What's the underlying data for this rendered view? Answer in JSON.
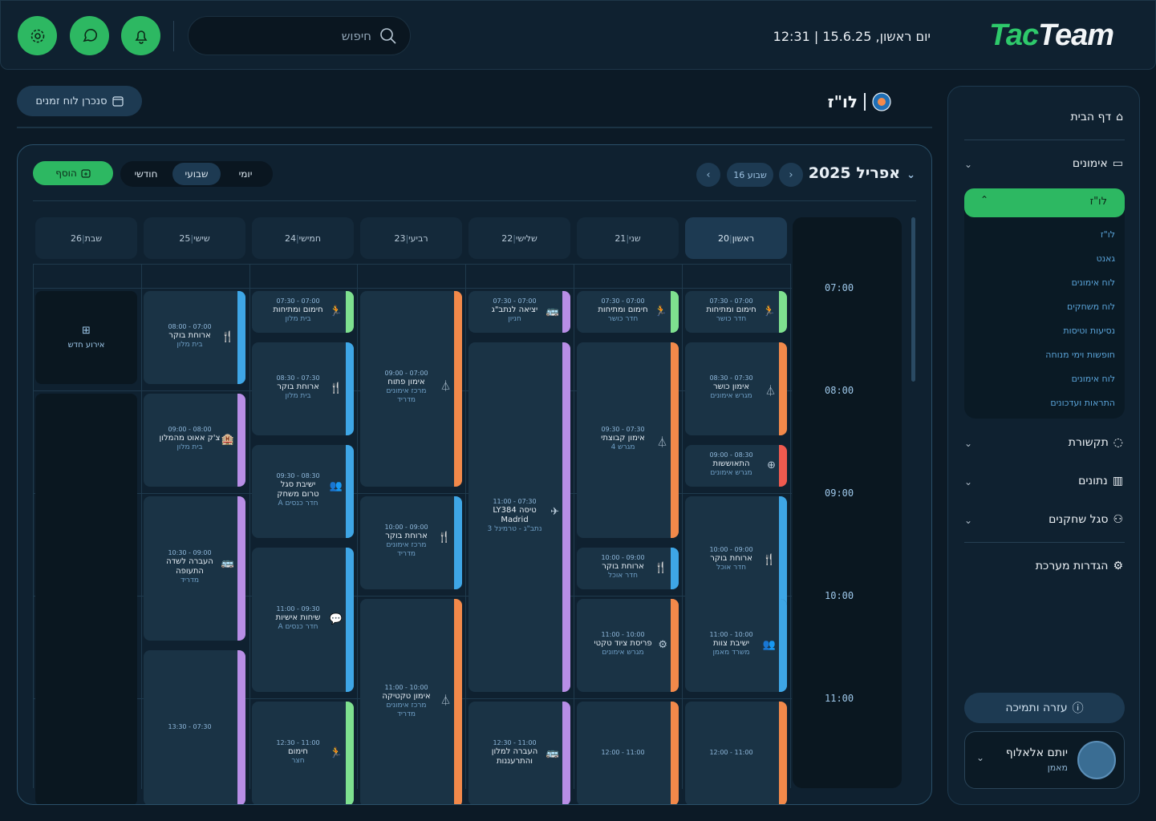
{
  "header": {
    "logo_a": "Tac",
    "logo_b": "Team",
    "datetime": "יום ראשון, 15.6.25 | 12:31",
    "search_placeholder": "חיפוש"
  },
  "sidebar": {
    "home": "דף הבית",
    "trainings": "אימונים",
    "active_sub": "לו\"ז",
    "sub_items": [
      "לו\"ז",
      "גאנט",
      "לוח אימונים",
      "לוח משחקים",
      "נסיעות וטיסות",
      "חופשות וימי מנוחה",
      "לוח אימונים",
      "התראות ועדכונים"
    ],
    "comms": "תקשורת",
    "data": "נתונים",
    "staff": "סגל שחקנים",
    "settings": "הגדרות מערכת",
    "help": "עזרה ותמיכה",
    "user_name": "יותם אלאלוף",
    "user_role": "מאמן"
  },
  "page": {
    "title": "לו\"ז",
    "sync_label": "סנכרן לוח זמנים"
  },
  "calendar": {
    "month": "אפריל 2025",
    "week": "שבוע 16",
    "views": {
      "day": "יומי",
      "week": "שבועי",
      "month": "חודשי"
    },
    "add_label": "הוסף",
    "days": [
      {
        "name": "ראשון",
        "num": "20"
      },
      {
        "name": "שני",
        "num": "21"
      },
      {
        "name": "שלישי",
        "num": "22"
      },
      {
        "name": "רביעי",
        "num": "23"
      },
      {
        "name": "חמישי",
        "num": "24"
      },
      {
        "name": "שישי",
        "num": "25"
      },
      {
        "name": "שבת",
        "num": "26"
      }
    ],
    "times": [
      "07:00",
      "08:00",
      "09:00",
      "10:00",
      "11:00"
    ],
    "new_event": "אירוע חדש",
    "colors": {
      "green": "#7ee08f",
      "orange": "#f2894a",
      "blue": "#3ea6e6",
      "purple": "#b88ee6",
      "red": "#ef5a4f"
    },
    "events": [
      {
        "t": "07:00 - 07:30",
        "n": "חימום ומתיחות",
        "l": "חדר כושר",
        "c": "#7ee08f",
        "i": "🏃"
      },
      {
        "t": "07:30 - 08:30",
        "n": "אימון כושר",
        "l": "מגרש אימונים",
        "c": "#f2894a",
        "i": "⏃"
      },
      {
        "t": "08:30 - 09:00",
        "n": "התאוששות",
        "l": "מגרש אימונים",
        "c": "#ef5a4f",
        "i": "⊕"
      },
      {
        "t": "09:00 - 10:00",
        "n": "ארוחת בוקר",
        "l": "חדר אוכל",
        "c": "#3ea6e6",
        "i": "🍴"
      },
      {
        "t": "10:00 - 11:00",
        "n": "ישיבת צוות",
        "l": "משרד מאמן",
        "c": "#3ea6e6",
        "i": "👥"
      },
      {
        "t": "11:00 - 12:00",
        "n": "",
        "l": "",
        "c": "#f2894a",
        "i": ""
      },
      {
        "t": "07:00 - 07:30",
        "n": "חימום ומתיחות",
        "l": "חדר כושר",
        "c": "#7ee08f",
        "i": "🏃"
      },
      {
        "t": "07:30 - 09:30",
        "n": "אימון קבוצתי",
        "l": "מגרש 4",
        "c": "#f2894a",
        "i": "⏃"
      },
      {
        "t": "09:00 - 10:00",
        "n": "ארוחת בוקר",
        "l": "חדר אוכל",
        "c": "#3ea6e6",
        "i": "🍴"
      },
      {
        "t": "10:00 - 11:00",
        "n": "פריסת ציוד טקטי",
        "l": "מגרש אימונים",
        "c": "#f2894a",
        "i": "⚙"
      },
      {
        "t": "11:00 - 12:00",
        "n": "",
        "l": "",
        "c": "#f2894a",
        "i": ""
      },
      {
        "t": "07:00 - 07:30",
        "n": "יציאה לנתב\"ג",
        "l": "חניון",
        "c": "#b88ee6",
        "i": "🚌"
      },
      {
        "t": "07:30 - 11:00",
        "n": "טיסה LY384",
        "n2": "Madrid",
        "l": "נתב\"ג - טרמינל 3",
        "c": "#b88ee6",
        "i": "✈"
      },
      {
        "t": "11:00 - 12:30",
        "n": "העברה למלון",
        "n2": "והתרעננות",
        "l": "",
        "c": "#b88ee6",
        "i": "🚌"
      },
      {
        "t": "07:00 - 09:00",
        "n": "אימון פתוח",
        "l": "מרכז אימונים",
        "l2": "מדריד",
        "c": "#f2894a",
        "i": "⏃"
      },
      {
        "t": "09:00 - 10:00",
        "n": "ארוחת בוקר",
        "l": "מרכז אימונים",
        "l2": "מדריד",
        "c": "#3ea6e6",
        "i": "🍴"
      },
      {
        "t": "10:00 - 11:00",
        "n": "אימון טקטיקה",
        "l": "מרכז אימונים",
        "l2": "מדריד",
        "c": "#f2894a",
        "i": "⏃"
      },
      {
        "t": "07:00 - 07:30",
        "n": "חימום ומתיחות",
        "l": "בית מלון",
        "c": "#7ee08f",
        "i": "🏃"
      },
      {
        "t": "07:30 - 08:30",
        "n": "ארוחת בוקר",
        "l": "בית מלון",
        "c": "#3ea6e6",
        "i": "🍴"
      },
      {
        "t": "08:30 - 09:30",
        "n": "ישיבת סגל",
        "n2": "טרום משחק",
        "l": "חדר כנסים A",
        "c": "#3ea6e6",
        "i": "👥"
      },
      {
        "t": "09:30 - 11:00",
        "n": "שיחות אישיות",
        "l": "חדר כנסים A",
        "c": "#3ea6e6",
        "i": "💬"
      },
      {
        "t": "11:00 - 12:30",
        "n": "חימום",
        "l": "חצר",
        "c": "#7ee08f",
        "i": "🏃"
      },
      {
        "t": "07:00 - 08:00",
        "n": "ארוחת בוקר",
        "l": "בית מלון",
        "c": "#3ea6e6",
        "i": "🍴"
      },
      {
        "t": "08:00 - 09:00",
        "n": "צ'ק אאוט מהמלון",
        "l": "בית מלון",
        "c": "#b88ee6",
        "i": "🏨"
      },
      {
        "t": "09:00 - 10:30",
        "n": "העברה לשדה",
        "n2": "התעופה",
        "l": "מדריד",
        "c": "#b88ee6",
        "i": "🚌"
      },
      {
        "t": "07:30 - 13:30",
        "n": "",
        "l": "",
        "c": "#b88ee6",
        "i": ""
      }
    ]
  }
}
